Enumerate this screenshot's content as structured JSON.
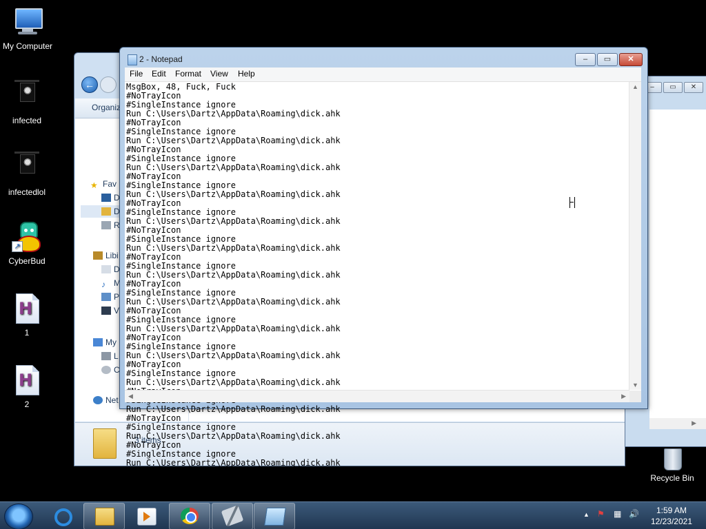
{
  "desktop": {
    "icons": [
      {
        "label": "My Computer",
        "icon": "computer-icon"
      },
      {
        "label": "infected",
        "icon": "skull-image-icon"
      },
      {
        "label": "infectedlol",
        "icon": "skull-image-icon"
      },
      {
        "label": "CyberBud",
        "icon": "cyberbud-shortcut-icon"
      },
      {
        "label": "1",
        "icon": "autohotkey-script-icon",
        "glyph": "H"
      },
      {
        "label": "2",
        "icon": "autohotkey-script-icon",
        "glyph": "H"
      },
      {
        "label": "Recycle Bin",
        "icon": "recycle-bin-icon"
      }
    ]
  },
  "explorer": {
    "toolbar_label": "Organiz",
    "nav": {
      "favorites": "Fav",
      "fav_items": [
        "D",
        "D",
        "R"
      ],
      "libraries": "Libi",
      "lib_items": [
        "D",
        "M",
        "P",
        "V"
      ],
      "computer": "My",
      "comp_items": [
        "L",
        "C"
      ],
      "network": "Net"
    },
    "status_count": "3 items"
  },
  "notepad": {
    "title": "2 - Notepad",
    "menu": [
      "File",
      "Edit",
      "Format",
      "View",
      "Help"
    ],
    "controls": {
      "minimize": "–",
      "maximize": "▭",
      "close": "✕"
    },
    "content": "MsgBox, 48, Fuck, Fuck\n#NoTrayIcon\n#SingleInstance ignore\nRun C:\\Users\\Dartz\\AppData\\Roaming\\dick.ahk\n#NoTrayIcon\n#SingleInstance ignore\nRun C:\\Users\\Dartz\\AppData\\Roaming\\dick.ahk\n#NoTrayIcon\n#SingleInstance ignore\nRun C:\\Users\\Dartz\\AppData\\Roaming\\dick.ahk\n#NoTrayIcon\n#SingleInstance ignore\nRun C:\\Users\\Dartz\\AppData\\Roaming\\dick.ahk\n#NoTrayIcon\n#SingleInstance ignore\nRun C:\\Users\\Dartz\\AppData\\Roaming\\dick.ahk\n#NoTrayIcon\n#SingleInstance ignore\nRun C:\\Users\\Dartz\\AppData\\Roaming\\dick.ahk\n#NoTrayIcon\n#SingleInstance ignore\nRun C:\\Users\\Dartz\\AppData\\Roaming\\dick.ahk\n#NoTrayIcon\n#SingleInstance ignore\nRun C:\\Users\\Dartz\\AppData\\Roaming\\dick.ahk\n#NoTrayIcon\n#SingleInstance ignore\nRun C:\\Users\\Dartz\\AppData\\Roaming\\dick.ahk\n#NoTrayIcon\n#SingleInstance ignore\nRun C:\\Users\\Dartz\\AppData\\Roaming\\dick.ahk\n#NoTrayIcon\n#SingleInstance ignore\nRun C:\\Users\\Dartz\\AppData\\Roaming\\dick.ahk\n#NoTrayIcon\n#SingleInstance ignore\nRun C:\\Users\\Dartz\\AppData\\Roaming\\dick.ahk\n#NoTrayIcon\n#SingleInstance ignore\nRun C:\\Users\\Dartz\\AppData\\Roaming\\dick.ahk\n#NoTrayIcon\n#SingleInstance ignore\nRun C:\\Users\\Dartz\\AppData\\Roaming\\dick.ahk"
  },
  "taskbar": {
    "apps": [
      "internet-explorer-icon",
      "file-explorer-icon",
      "media-center-icon",
      "chrome-icon",
      "tool-icon",
      "notepad-icon"
    ],
    "tray": {
      "show_hidden": "▲",
      "flag": "⚑",
      "network": "▦",
      "volume": "🔊"
    },
    "time": "1:59 AM",
    "date": "12/23/2021"
  }
}
